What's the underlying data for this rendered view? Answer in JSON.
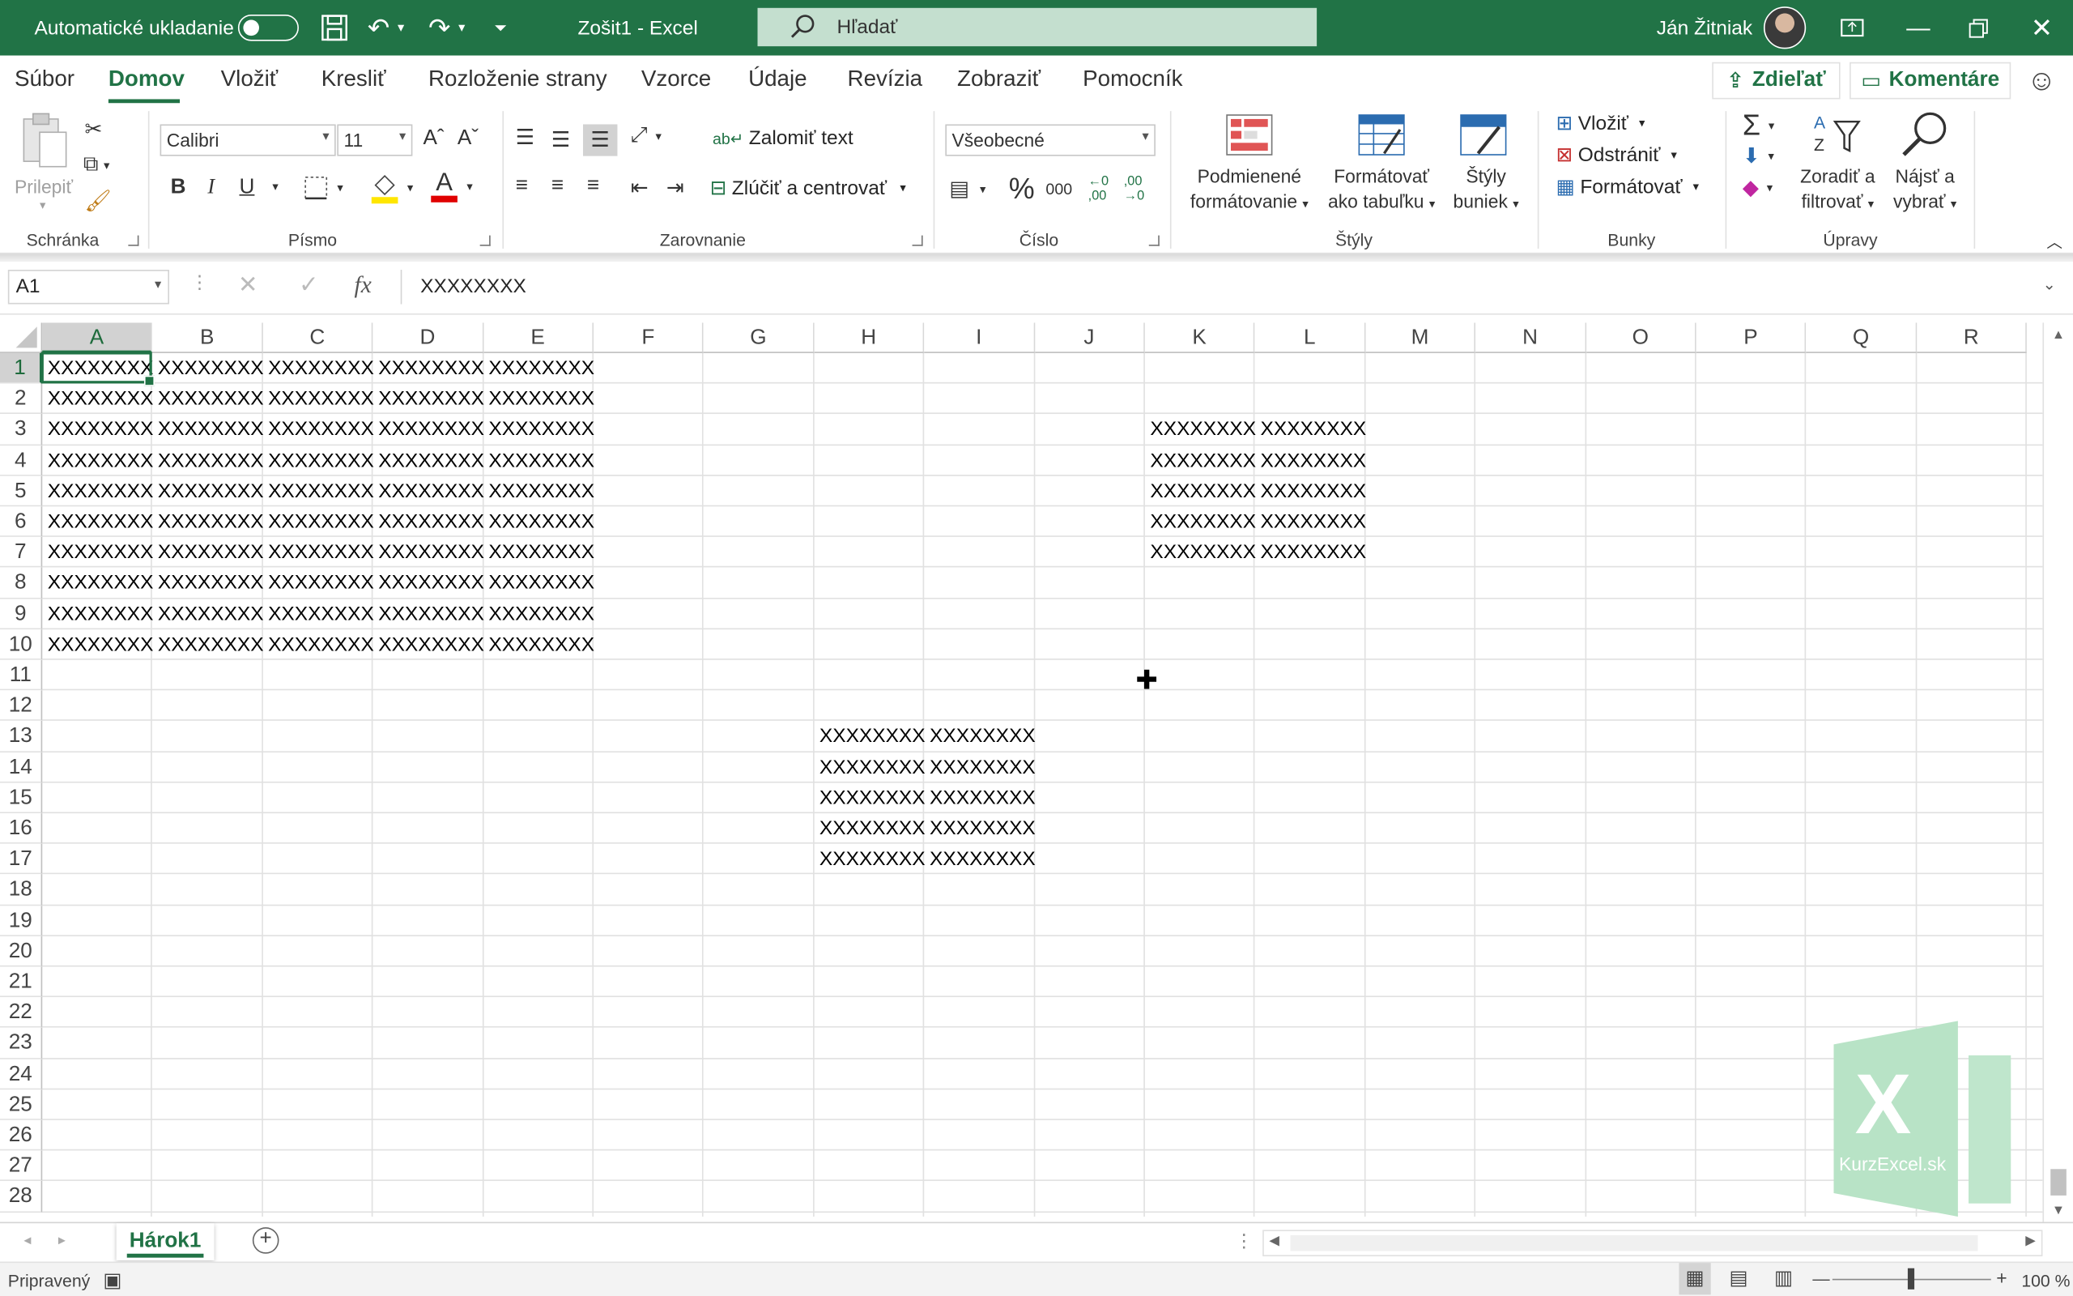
{
  "titlebar": {
    "autosave_label": "Automatické ukladanie",
    "doc_title": "Zošit1  -  Excel",
    "search_placeholder": "Hľadať",
    "user_name": "Ján Žitniak"
  },
  "menu": {
    "tabs": [
      "Súbor",
      "Domov",
      "Vložiť",
      "Kresliť",
      "Rozloženie strany",
      "Vzorce",
      "Údaje",
      "Revízia",
      "Zobraziť",
      "Pomocník"
    ],
    "active": "Domov",
    "share_label": "Zdieľať",
    "comments_label": "Komentáre"
  },
  "ribbon": {
    "clipboard": {
      "paste_label": "Prilepiť",
      "group_label": "Schránka"
    },
    "font": {
      "name": "Calibri",
      "size": "11",
      "group_label": "Písmo",
      "bold": "B",
      "italic": "I",
      "underline": "U",
      "font_color": "A",
      "grow": "Aˆ",
      "shrink": "Aˇ"
    },
    "alignment": {
      "wrap_label": "Zalomiť text",
      "merge_label": "Zlúčiť a centrovať",
      "group_label": "Zarovnanie"
    },
    "number": {
      "format": "Všeobecné",
      "group_label": "Číslo",
      "percent": "%",
      "thousands": "000",
      "inc_decimal": "←0\n,00",
      "dec_decimal": ",00\n→0"
    },
    "styles": {
      "conditional_l1": "Podmienené",
      "conditional_l2": "formátovanie",
      "table_l1": "Formátovať",
      "table_l2": "ako tabuľku",
      "cell_l1": "Štýly",
      "cell_l2": "buniek",
      "group_label": "Štýly"
    },
    "cells": {
      "insert_label": "Vložiť",
      "delete_label": "Odstrániť",
      "format_label": "Formátovať",
      "group_label": "Bunky"
    },
    "editing": {
      "sort_l1": "Zoradiť a",
      "sort_l2": "filtrovať",
      "find_l1": "Nájsť a",
      "find_l2": "vybrať",
      "group_label": "Úpravy"
    }
  },
  "formula_bar": {
    "name_box": "A1",
    "fx": "fx",
    "content": "XXXXXXXX"
  },
  "grid": {
    "columns": [
      "A",
      "B",
      "C",
      "D",
      "E",
      "F",
      "G",
      "H",
      "I",
      "J",
      "K",
      "L",
      "M",
      "N",
      "O",
      "P",
      "Q",
      "R"
    ],
    "rows": [
      "1",
      "2",
      "3",
      "4",
      "5",
      "6",
      "7",
      "8",
      "9",
      "10",
      "11",
      "12",
      "13",
      "14",
      "15",
      "16",
      "17",
      "18",
      "19",
      "20",
      "21",
      "22",
      "23",
      "24",
      "25",
      "26",
      "27",
      "28"
    ],
    "selected_cell": "A1",
    "filled": [
      {
        "range": "A1:E10",
        "value": "XXXXXXXX"
      },
      {
        "range": "K3:L7",
        "value": "XXXXXXXX"
      },
      {
        "range": "H13:I17",
        "value": "XXXXXXXX"
      }
    ]
  },
  "watermark": {
    "letter": "X",
    "text": "KurzExcel.sk"
  },
  "sheets": {
    "tabs": [
      "Hárok1"
    ],
    "active": "Hárok1"
  },
  "status": {
    "ready": "Pripravený",
    "zoom": "100 %"
  },
  "colors": {
    "accent": "#217346",
    "search_bg": "#c4dfcf"
  }
}
